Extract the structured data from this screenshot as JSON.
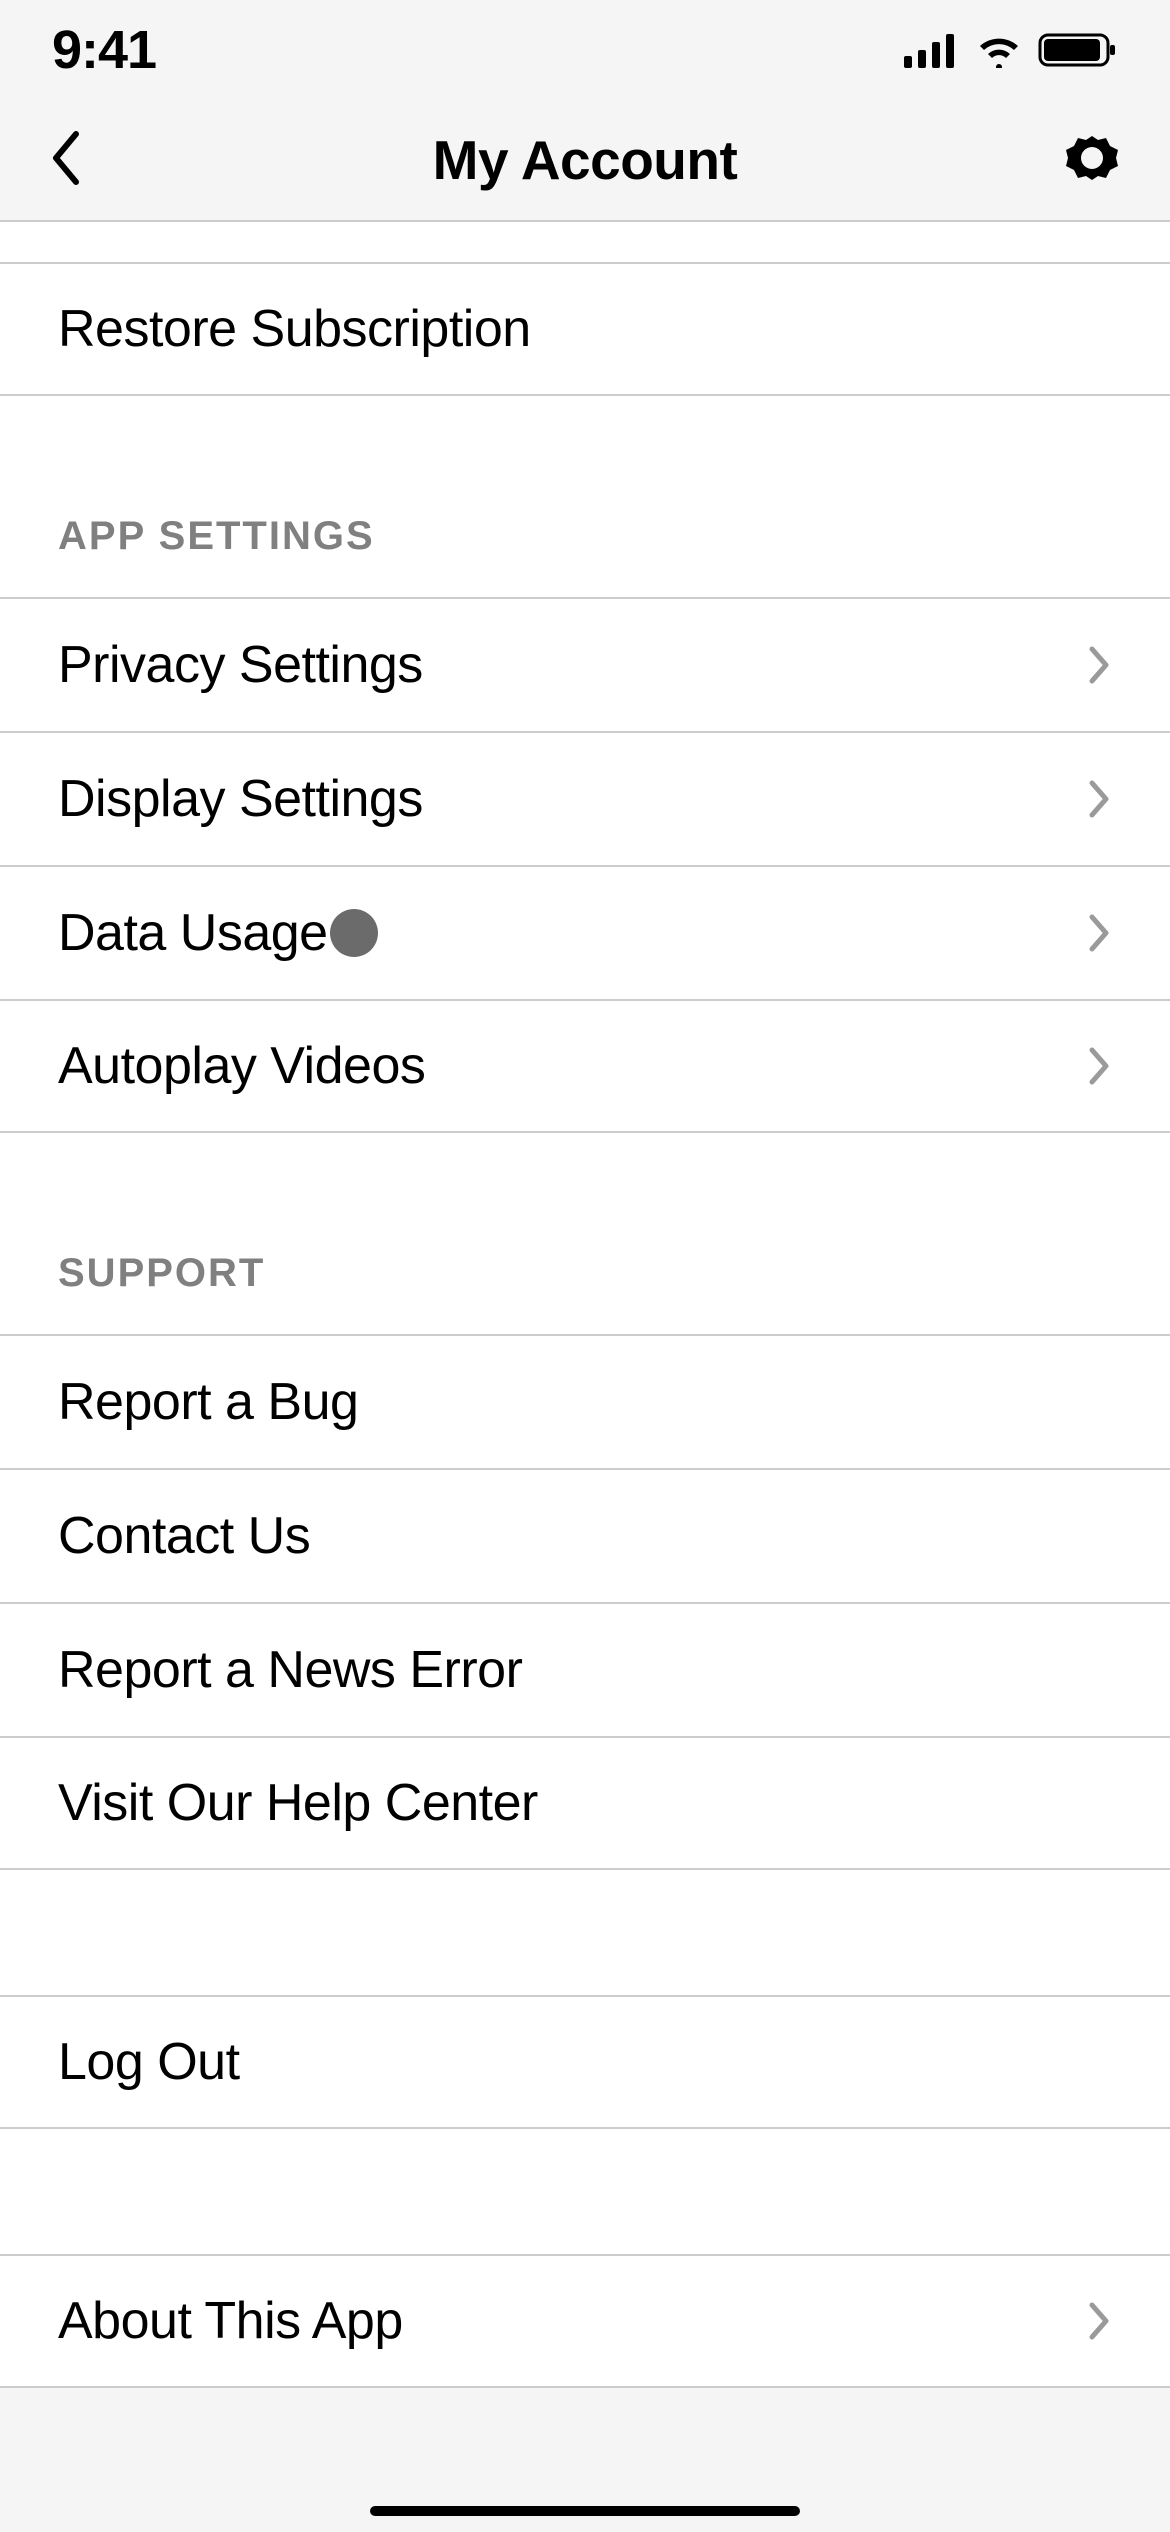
{
  "statusBar": {
    "time": "9:41"
  },
  "header": {
    "title": "My Account"
  },
  "topItems": [
    {
      "id": "restore-subscription",
      "label": "Restore Subscription",
      "hasChevron": false
    }
  ],
  "sections": [
    {
      "id": "app-settings",
      "title": "APP SETTINGS",
      "items": [
        {
          "id": "privacy-settings",
          "label": "Privacy Settings",
          "hasChevron": true,
          "hasDot": false
        },
        {
          "id": "display-settings",
          "label": "Display Settings",
          "hasChevron": true,
          "hasDot": false
        },
        {
          "id": "data-usage",
          "label": "Data Usage",
          "hasChevron": true,
          "hasDot": true
        },
        {
          "id": "autoplay-videos",
          "label": "Autoplay Videos",
          "hasChevron": true,
          "hasDot": false
        }
      ]
    },
    {
      "id": "support",
      "title": "SUPPORT",
      "items": [
        {
          "id": "report-bug",
          "label": "Report a Bug",
          "hasChevron": false
        },
        {
          "id": "contact-us",
          "label": "Contact Us",
          "hasChevron": false
        },
        {
          "id": "report-news-error",
          "label": "Report a News Error",
          "hasChevron": false
        },
        {
          "id": "visit-help-center",
          "label": "Visit Our Help Center",
          "hasChevron": false
        }
      ]
    }
  ],
  "logOutItem": {
    "id": "log-out",
    "label": "Log Out",
    "hasChevron": false
  },
  "aboutItem": {
    "id": "about-app",
    "label": "About This App",
    "hasChevron": true
  }
}
